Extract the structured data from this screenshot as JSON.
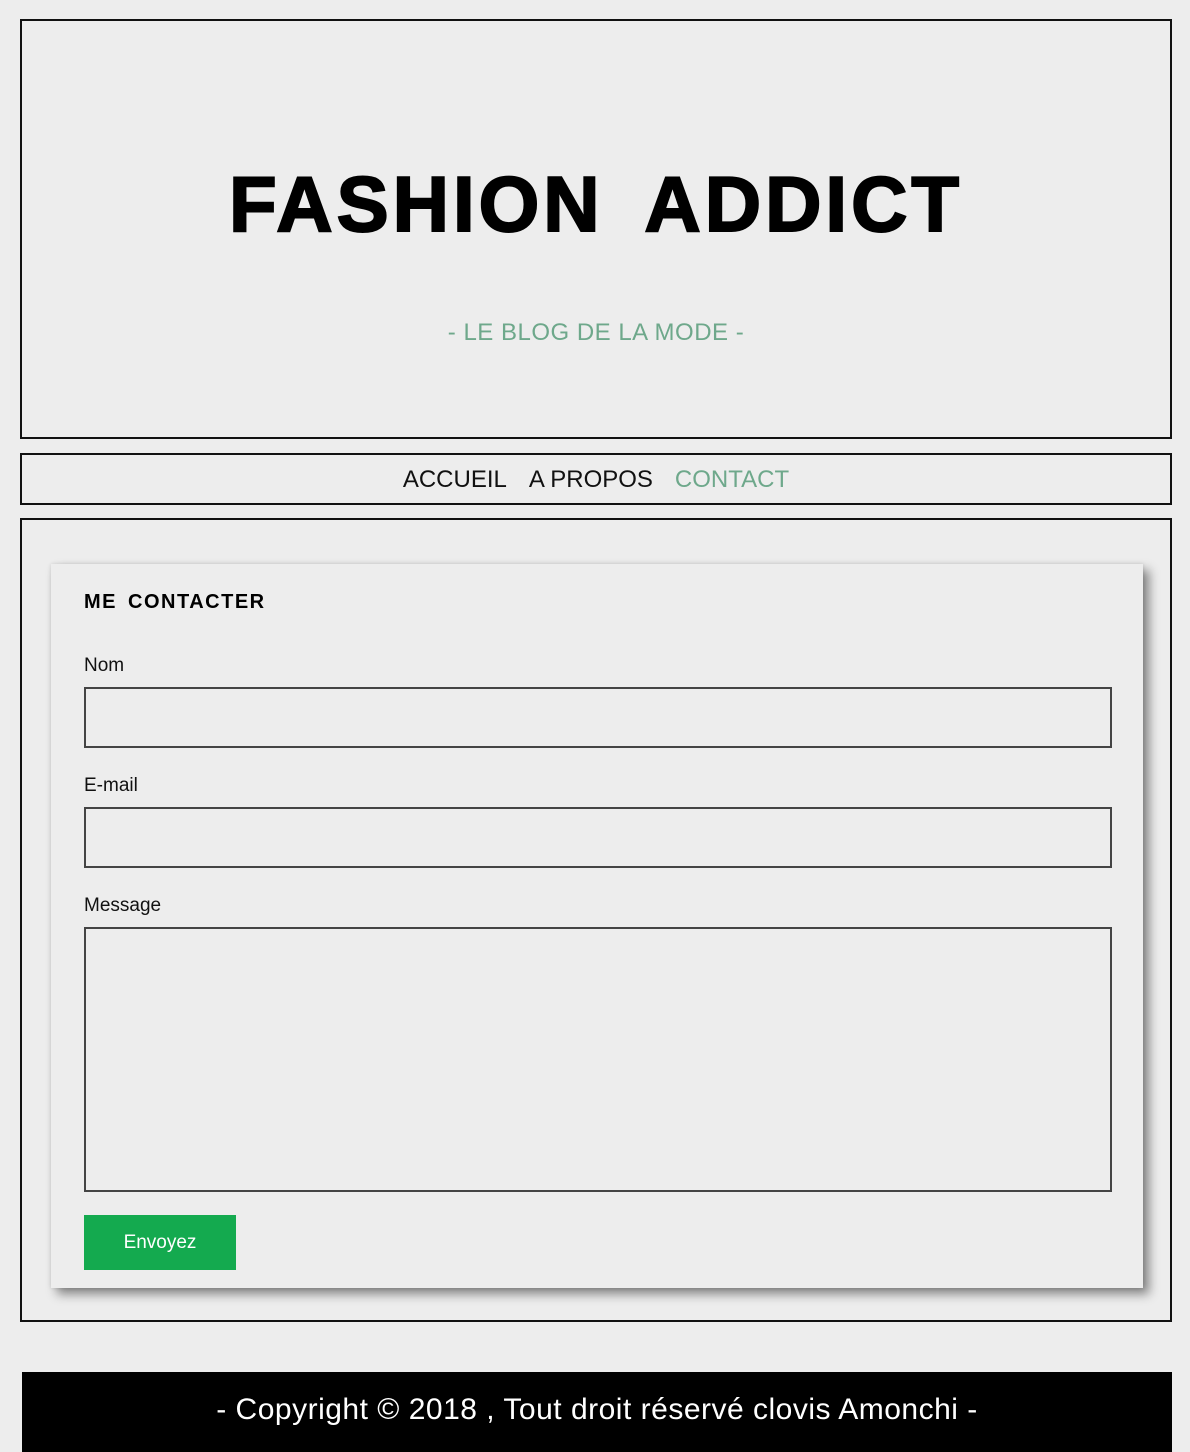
{
  "header": {
    "title": "FASHION ADDICT",
    "subtitle": "- LE BLOG DE LA MODE -"
  },
  "nav": {
    "items": [
      {
        "label": "ACCUEIL",
        "active": false
      },
      {
        "label": "A PROPOS",
        "active": false
      },
      {
        "label": "CONTACT",
        "active": true
      }
    ]
  },
  "contact_form": {
    "title": "ME CONTACTER",
    "name_label": "Nom",
    "name_value": "",
    "email_label": "E-mail",
    "email_value": "",
    "message_label": "Message",
    "message_value": "",
    "submit_label": "Envoyez"
  },
  "footer": {
    "text": "- Copyright © 2018 , Tout droit réservé clovis Amonchi -"
  },
  "colors": {
    "accent": "#6ea88b",
    "button": "#14aa4f",
    "background": "#ededed",
    "footer_bg": "#000000"
  }
}
